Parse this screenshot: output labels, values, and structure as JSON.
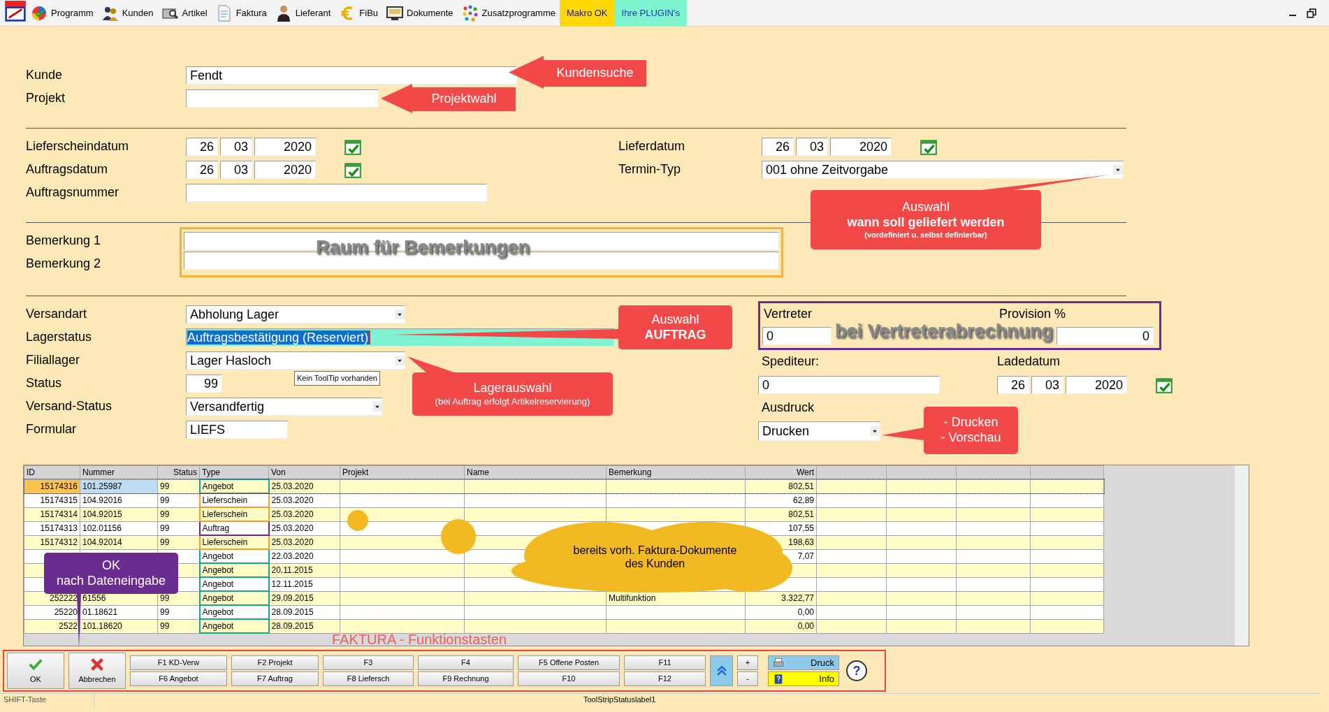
{
  "toolbar": {
    "items": [
      {
        "label": "Programm"
      },
      {
        "label": "Kunden"
      },
      {
        "label": "Artikel"
      },
      {
        "label": "Faktura"
      },
      {
        "label": "Lieferant"
      },
      {
        "label": "FiBu"
      },
      {
        "label": "Dokumente"
      },
      {
        "label": "Zusatzprogramme"
      }
    ],
    "macro_button": "Makro OK",
    "plugins_button": "Ihre PLUGIN's"
  },
  "form": {
    "customer": {
      "label": "Kunde",
      "value": "Fendt"
    },
    "project": {
      "label": "Projekt"
    },
    "delivery_note_date": {
      "label": "Lieferscheindatum",
      "day": "26",
      "month": "03",
      "year": "2020"
    },
    "order_date": {
      "label": "Auftragsdatum",
      "day": "26",
      "month": "03",
      "year": "2020"
    },
    "order_number": {
      "label": "Auftragsnummer"
    },
    "delivery_date": {
      "label": "Lieferdatum",
      "day": "26",
      "month": "03",
      "year": "2020"
    },
    "appointment_type": {
      "label": "Termin-Typ",
      "value": "001 ohne Zeitvorgabe"
    },
    "remarks": [
      {
        "label": "Bemerkung 1"
      },
      {
        "label": "Bemerkung 2"
      }
    ],
    "shipping_method": {
      "label": "Versandart",
      "value": "Abholung Lager"
    },
    "stock_status": {
      "label": "Lagerstatus",
      "value": "Auftragsbestätigung (Reserviert)"
    },
    "branch_stock": {
      "label": "Filiallager",
      "value": "Lager Hasloch"
    },
    "status": {
      "label": "Status",
      "value": "99"
    },
    "shipping_status": {
      "label": "Versand-Status",
      "value": "Versandfertig"
    },
    "form_name": {
      "label": "Formular",
      "value": "LIEFS"
    },
    "representative": {
      "label": "Vertreter",
      "value": "0"
    },
    "commission": {
      "label": "Provision %",
      "value": "0"
    },
    "forwarder": {
      "label": "Spediteur:",
      "value": "0"
    },
    "loading_date": {
      "label": "Ladedatum",
      "day": "26",
      "month": "03",
      "year": "2020"
    },
    "printout": {
      "label": "Ausdruck",
      "value": "Drucken"
    }
  },
  "tooltip": "Kein ToolTip vorhanden",
  "table": {
    "columns": [
      "ID",
      "Nummer",
      "Status",
      "Type",
      "Von",
      "Projekt",
      "Name",
      "Bemerkung",
      "Wert"
    ],
    "rows": [
      {
        "selected": true,
        "color": "#1aa58a",
        "cells": [
          "15174316",
          "101.25987",
          "99",
          "Angebot",
          "25.03.2020",
          "",
          "",
          "",
          "802,51"
        ]
      },
      {
        "selected": false,
        "color": "#f0a030",
        "cells": [
          "15174315",
          "104.92016",
          "99",
          "Lieferschein",
          "25.03.2020",
          "",
          "",
          "",
          "62,89"
        ]
      },
      {
        "selected": false,
        "color": "#f0a030",
        "cells": [
          "15174314",
          "104.92015",
          "99",
          "Lieferschein",
          "25.03.2020",
          "",
          "",
          "",
          "802,51"
        ]
      },
      {
        "selected": false,
        "color": "#6a2a8a",
        "cells": [
          "15174313",
          "102.01156",
          "99",
          "Auftrag",
          "25.03.2020",
          "",
          "",
          "",
          "107,55"
        ]
      },
      {
        "selected": false,
        "color": "#f0a030",
        "cells": [
          "15174312",
          "104.92014",
          "99",
          "Lieferschein",
          "25.03.2020",
          "",
          "",
          "",
          "198,63"
        ]
      },
      {
        "selected": false,
        "color": "#1aa58a",
        "cells": [
          "",
          "",
          "",
          "Angebot",
          "22.03.2020",
          "",
          "",
          "",
          "7,07"
        ]
      },
      {
        "selected": false,
        "color": "#1aa58a",
        "cells": [
          "",
          "",
          "",
          "Angebot",
          "20.11.2015",
          "",
          "",
          "",
          ""
        ]
      },
      {
        "selected": false,
        "color": "#1aa58a",
        "cells": [
          "",
          "",
          "",
          "Angebot",
          "12.11.2015",
          "",
          "",
          "",
          ""
        ]
      },
      {
        "selected": false,
        "color": "#1aa58a",
        "cells": [
          "252222",
          "61556",
          "99",
          "Angebot",
          "29.09.2015",
          "",
          "",
          "Multifunktion",
          "3.322,77"
        ]
      },
      {
        "selected": false,
        "color": "#1aa58a",
        "cells": [
          "25220",
          "01.18621",
          "99",
          "Angebot",
          "28.09.2015",
          "",
          "",
          "",
          "0,00"
        ]
      },
      {
        "selected": false,
        "color": "#1aa58a",
        "cells": [
          "2522",
          "101.18620",
          "99",
          "Angebot",
          "28.09.2015",
          "",
          "",
          "",
          "0,00"
        ]
      }
    ]
  },
  "function_keys": {
    "ok": "OK",
    "cancel": "Abbrechen",
    "pairs": [
      [
        "F1 KD-Verw",
        "F6 Angebot"
      ],
      [
        "F2 Projekt",
        "F7 Auftrag"
      ],
      [
        "F3",
        "F8 Liefersch"
      ],
      [
        "F4",
        "F9 Rechnung"
      ],
      [
        "F5 Offene Posten",
        "F10"
      ],
      [
        "F11",
        "F12"
      ]
    ],
    "plus": "+",
    "minus": "-",
    "print": "Druck",
    "info": "Info",
    "help": "?"
  },
  "status_bar": [
    "SHIFT-Taste",
    "ToolStripStatuslabel1"
  ],
  "annotations": [
    {
      "kind": "arrow",
      "color": "#f24848",
      "lines": [
        {
          "kind": "plain",
          "text": "Kundensuche"
        }
      ]
    },
    {
      "kind": "arrow",
      "color": "#f24848",
      "lines": [
        {
          "kind": "plain",
          "text": "Projektwahl"
        }
      ]
    },
    {
      "kind": "callout",
      "color": "#f24848",
      "lines": [
        {
          "kind": "plain",
          "text": "Auswahl"
        },
        {
          "kind": "bold",
          "text": "wann soll geliefert werden"
        },
        {
          "kind": "note",
          "text": "(vordefiniert u. selbst definierbar)"
        }
      ]
    },
    {
      "kind": "shadow",
      "lines": [
        {
          "kind": "plain",
          "text": "Raum für Bemerkungen"
        }
      ]
    },
    {
      "kind": "callout",
      "color": "#f24848",
      "lines": [
        {
          "kind": "plain",
          "text": "Auswahl"
        },
        {
          "kind": "bold",
          "text": "AUFTRAG"
        }
      ]
    },
    {
      "kind": "shadow",
      "lines": [
        {
          "kind": "plain",
          "text": "bei Vertreterabrechnung"
        }
      ]
    },
    {
      "kind": "callout",
      "color": "#f24848",
      "lines": [
        {
          "kind": "plain",
          "text": "Lagerauswahl"
        },
        {
          "kind": "small",
          "text": "(bei Auftrag erfolgt Artikelreservierung)"
        }
      ]
    },
    {
      "kind": "callout",
      "color": "#f24848",
      "lines": [
        {
          "kind": "plain",
          "text": "- Drucken"
        },
        {
          "kind": "plain",
          "text": "- Vorschau"
        }
      ]
    },
    {
      "kind": "cloud",
      "color": "#f3b922",
      "lines": [
        {
          "kind": "plain",
          "text": "bereits vorh. Faktura-Dokumente"
        },
        {
          "kind": "plain",
          "text": "des Kunden"
        }
      ]
    },
    {
      "kind": "callout",
      "color": "#6b2c8f",
      "lines": [
        {
          "kind": "plain",
          "text": "OK"
        },
        {
          "kind": "plain",
          "text": "nach Dateneingabe"
        }
      ]
    },
    {
      "kind": "label",
      "color": "#f25c5c",
      "lines": [
        {
          "kind": "plain",
          "text": "FAKTURA - Funktionstasten"
        }
      ]
    }
  ]
}
